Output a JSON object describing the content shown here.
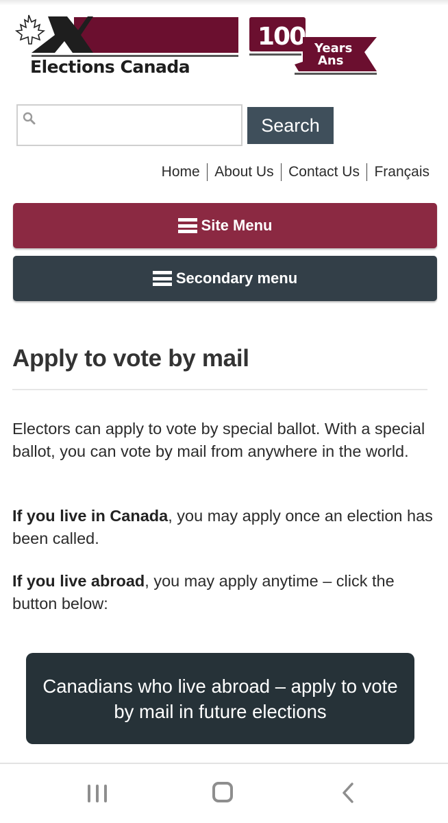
{
  "brand": {
    "name": "Elections Canada",
    "anniversary_number": "100",
    "anniversary_en": "Years",
    "anniversary_fr": "Ans",
    "colors": {
      "maroon": "#6b0f2f",
      "black": "#1e1e1e"
    }
  },
  "search": {
    "value": "",
    "placeholder": "",
    "button_label": "Search"
  },
  "top_links": [
    {
      "label": "Home"
    },
    {
      "label": "About Us"
    },
    {
      "label": "Contact Us"
    },
    {
      "label": "Français"
    }
  ],
  "menus": {
    "site_menu_label": "Site Menu",
    "secondary_menu_label": "Secondary menu",
    "site_menu_color": "#8b2942",
    "secondary_menu_color": "#333f48"
  },
  "content": {
    "title": "Apply to vote by mail",
    "paragraph1": "Electors can apply to vote by special ballot. With a special ballot, you can vote by mail from anywhere in the world.",
    "paragraph2_bold": "If you live in Canada",
    "paragraph2_rest": ", you may apply once an election has been called.",
    "paragraph3_bold": "If you live abroad",
    "paragraph3_rest": ", you may apply anytime – click the button below:",
    "cta_label": "Canadians who live abroad – apply to vote by mail in future elections"
  },
  "system_nav": {
    "recents": "recents-icon",
    "home": "home-icon",
    "back": "back-icon"
  }
}
